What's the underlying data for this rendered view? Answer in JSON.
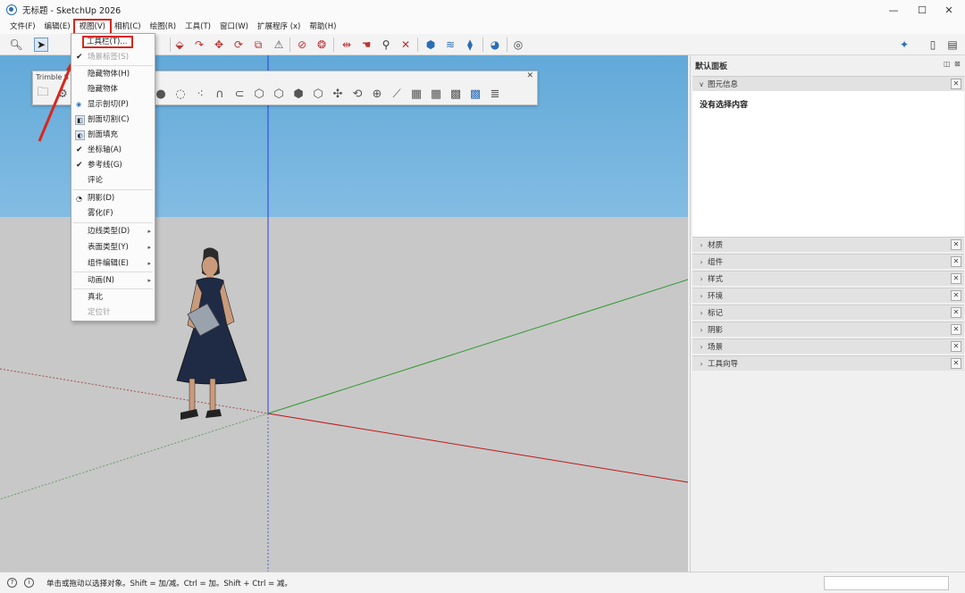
{
  "window": {
    "title": "无标题 - SketchUp 2026",
    "minimize": "—",
    "maximize": "☐",
    "close": "✕"
  },
  "menubar": {
    "items": [
      "文件(F)",
      "编辑(E)",
      "视图(V)",
      "相机(C)",
      "绘图(R)",
      "工具(T)",
      "窗口(W)",
      "扩展程序 (x)",
      "帮助(H)"
    ]
  },
  "floating_toolbar": {
    "title": "Trimble S",
    "close": "✕"
  },
  "view_menu": {
    "items": [
      {
        "label": "工具栏(T)...",
        "mark": ""
      },
      {
        "label": "场景标签(S)",
        "mark": "✔"
      },
      {
        "label": "隐藏物体(H)",
        "mark": ""
      },
      {
        "label": "隐藏物体",
        "mark": ""
      },
      {
        "label": "显示剖切(P)",
        "mark": "◉"
      },
      {
        "label": "剖面切割(C)",
        "mark": "◧"
      },
      {
        "label": "剖面填充",
        "mark": "◐"
      },
      {
        "label": "坐标轴(A)",
        "mark": "✔"
      },
      {
        "label": "参考线(G)",
        "mark": "✔"
      },
      {
        "label": "评论",
        "mark": ""
      },
      {
        "label": "阴影(D)",
        "mark": "◔"
      },
      {
        "label": "雾化(F)",
        "mark": ""
      },
      {
        "label": "边线类型(D)",
        "mark": "",
        "submenu": "▸"
      },
      {
        "label": "表面类型(Y)",
        "mark": "",
        "submenu": "▸"
      },
      {
        "label": "组件编辑(E)",
        "mark": "",
        "submenu": "▸"
      },
      {
        "label": "动画(N)",
        "mark": "",
        "submenu": "▸"
      },
      {
        "label": "真北",
        "mark": ""
      },
      {
        "label": "定位针",
        "mark": "",
        "disabled": true
      }
    ]
  },
  "tray": {
    "title": "默认面板",
    "pin": "◫",
    "close": "⊠",
    "entity_info": {
      "label": "图元信息",
      "empty_text": "没有选择内容"
    },
    "panels": [
      "材质",
      "组件",
      "样式",
      "环境",
      "标记",
      "阴影",
      "场景",
      "工具向导"
    ],
    "panel_close": "✕",
    "chevron_open": "∨",
    "chevron_closed": "›"
  },
  "statusbar": {
    "text": "单击或拖动以选择对象。Shift = 加/减。Ctrl = 加。Shift + Ctrl = 减。",
    "icon1": "?",
    "icon2": "i"
  },
  "colors": {
    "highlight_red": "#d9261c",
    "axis_red": "#c01818",
    "axis_green": "#2f9a2f",
    "axis_blue": "#2a3fd6",
    "sky_top": "#62a9d9",
    "ground": "#c8c8c8"
  }
}
